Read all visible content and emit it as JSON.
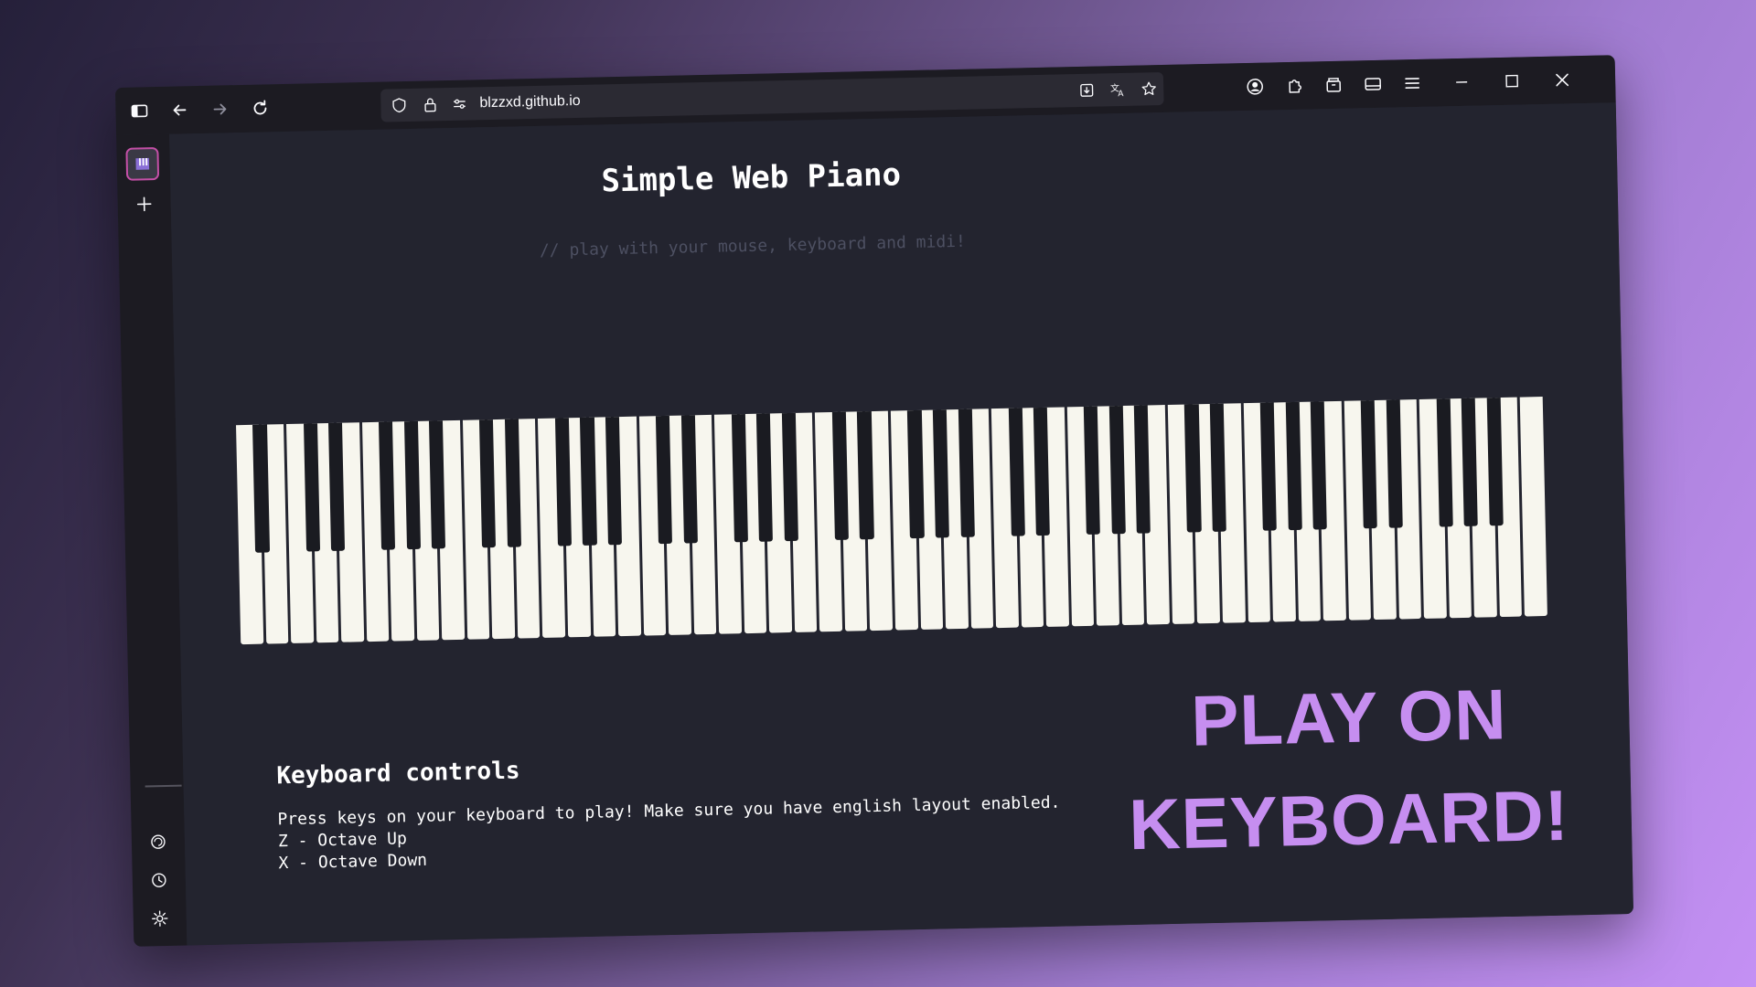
{
  "browser": {
    "url": "blzzxd.github.io",
    "toolbar_icons": [
      "sidebar-toggle-icon",
      "back-arrow-icon",
      "forward-arrow-icon",
      "reload-icon"
    ],
    "url_icons": [
      "shield-icon",
      "lock-icon",
      "permissions-icon"
    ],
    "url_actions": [
      "download-page-icon",
      "translate-icon",
      "bookmark-star-icon"
    ],
    "right_icons": [
      "account-icon",
      "extensions-icon",
      "container-icon",
      "sidebar-panel-icon",
      "menu-icon"
    ],
    "window_controls": [
      "minimize-icon",
      "maximize-icon",
      "close-icon"
    ]
  },
  "sidebar": {
    "tabs": [
      {
        "name": "piano-tab",
        "icon": "piano-favicon"
      }
    ],
    "bottom_icons": [
      "chatbot-icon",
      "history-icon",
      "settings-icon"
    ]
  },
  "page": {
    "title": "Simple Web Piano",
    "subtitle": "// play with your mouse, keyboard and midi!",
    "piano": {
      "white_keys": 52,
      "black_keys": 36,
      "first_key": "A0",
      "last_key": "C8"
    },
    "controls": {
      "heading": "Keyboard controls",
      "lines": [
        "Press keys on your keyboard to play! Make sure you have english layout enabled.",
        "Z - Octave Up",
        "X - Octave Down"
      ]
    }
  },
  "overlay": {
    "line1": "PLAY ON",
    "line2": "KEYBOARD!",
    "color": "#c68ef0"
  },
  "colors": {
    "window_bg": "#23242f",
    "chrome_bg": "#1c1b22",
    "urlbar_bg": "#2b2a33",
    "active_tab_border": "#c34fa6",
    "white_key": "#f7f6ee",
    "black_key": "#1a1b21"
  }
}
